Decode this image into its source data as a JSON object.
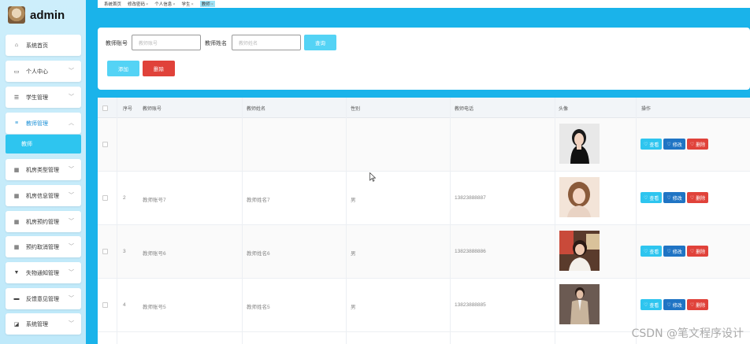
{
  "brand": {
    "title": "admin"
  },
  "sidebar": {
    "items": [
      {
        "label": "系统首页",
        "icon": "home-icon",
        "glyph": "⌂"
      },
      {
        "label": "个人中心",
        "icon": "user-card-icon",
        "glyph": "▭"
      },
      {
        "label": "学生管理",
        "icon": "sliders-icon",
        "glyph": "☰"
      },
      {
        "label": "教师管理",
        "icon": "list-icon",
        "glyph": "≡"
      },
      {
        "label": "机房类型管理",
        "icon": "grid-icon",
        "glyph": "▦"
      },
      {
        "label": "机房信息管理",
        "icon": "grid-icon",
        "glyph": "▦"
      },
      {
        "label": "机房预约管理",
        "icon": "grid-icon",
        "glyph": "▦"
      },
      {
        "label": "预约取消管理",
        "icon": "grid-icon",
        "glyph": "▦"
      },
      {
        "label": "失物通知管理",
        "icon": "pin-icon",
        "glyph": "▼"
      },
      {
        "label": "反馈意见管理",
        "icon": "printer-icon",
        "glyph": "▬"
      },
      {
        "label": "系统管理",
        "icon": "settings-icon",
        "glyph": "◪"
      }
    ],
    "sub_active": "教师"
  },
  "tabs": [
    "系统首页",
    "修改密码",
    "个人信息",
    "学生",
    "教师"
  ],
  "search": {
    "account_label": "教师账号",
    "account_placeholder": "教师账号",
    "name_label": "教师姓名",
    "name_placeholder": "教师姓名",
    "query_label": "查询",
    "add_label": "添加",
    "delete_label": "删除"
  },
  "table": {
    "headers": [
      "序号",
      "教师账号",
      "教师姓名",
      "性别",
      "教师电话",
      "头像",
      "操作"
    ],
    "rows": [
      {
        "index": "",
        "account": "",
        "name": "",
        "gender": "",
        "phone": ""
      },
      {
        "index": "2",
        "account": "教师账号7",
        "name": "教师姓名7",
        "gender": "男",
        "phone": "13823888887"
      },
      {
        "index": "3",
        "account": "教师账号6",
        "name": "教师姓名6",
        "gender": "男",
        "phone": "13823888886"
      },
      {
        "index": "4",
        "account": "教师账号5",
        "name": "教师姓名5",
        "gender": "男",
        "phone": "13823888885"
      }
    ],
    "actions": {
      "view": "查看",
      "edit": "修改",
      "delete": "删除"
    }
  },
  "watermark": "CSDN @笔文程序设计",
  "colors": {
    "accent": "#1ab3ea",
    "view": "#2ec5ef",
    "edit": "#1f74c4",
    "danger": "#e0423a"
  }
}
